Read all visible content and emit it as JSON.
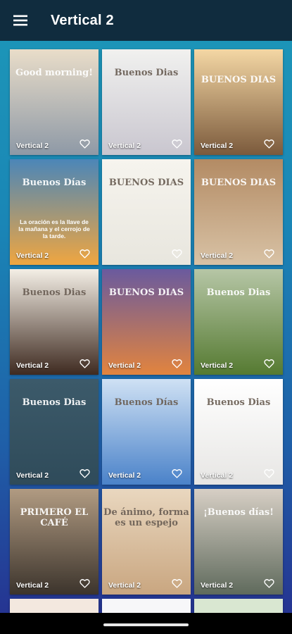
{
  "app_bar": {
    "title": "Vertical 2",
    "menu_icon": "hamburger-menu-icon"
  },
  "gallery": {
    "items": [
      {
        "label": "Vertical 2",
        "art_text": "Good morning!",
        "colors": [
          "#e9ddc9",
          "#8e99a6"
        ],
        "icon": "heart-outline-icon"
      },
      {
        "label": "Vertical 2",
        "art_text": "Buenos Dias",
        "colors": [
          "#f1f1ef",
          "#c9c6cf"
        ],
        "icon": "heart-outline-icon"
      },
      {
        "label": "Vertical 2",
        "art_text": "BUENOS DIAS",
        "colors": [
          "#f4d7a4",
          "#7b5a3c"
        ],
        "icon": "heart-outline-icon"
      },
      {
        "label": "Vertical 2",
        "art_text": "Buenos Días",
        "quote": "La oración es la llave de la mañana y el cerrojo de la tarde.",
        "colors": [
          "#4b86b8",
          "#f0a640"
        ],
        "icon": "heart-outline-icon"
      },
      {
        "label": "",
        "art_text": "BUENOS DIAS",
        "colors": [
          "#f6f4ee",
          "#e8e6de"
        ],
        "icon": "heart-outline-icon"
      },
      {
        "label": "Vertical 2",
        "art_text": "BUENOS DIAS",
        "colors": [
          "#b38b64",
          "#d8c2a5"
        ],
        "icon": "heart-outline-icon"
      },
      {
        "label": "Vertical 2",
        "art_text": "Buenos Dias",
        "colors": [
          "#f4efe6",
          "#3e2a20"
        ],
        "icon": "heart-outline-icon"
      },
      {
        "label": "Vertical 2",
        "art_text": "BUENOS DIAS",
        "colors": [
          "#6a5a9e",
          "#e2843e"
        ],
        "icon": "heart-outline-icon"
      },
      {
        "label": "Vertical 2",
        "art_text": "Buenos Dias",
        "colors": [
          "#b6c6a6",
          "#557a31"
        ],
        "icon": "heart-outline-icon"
      },
      {
        "label": "Vertical 2",
        "art_text": "Buenos Dias",
        "colors": [
          "#3c5a6a",
          "#2f4b5a"
        ],
        "icon": "heart-outline-icon"
      },
      {
        "label": "Vertical 2",
        "art_text": "Buenos Días",
        "colors": [
          "#cfe1f4",
          "#4a82c9"
        ],
        "icon": "heart-outline-icon"
      },
      {
        "label": "Vertical 2",
        "art_text": "Buenos Dias",
        "colors": [
          "#ffffff",
          "#e7e6e4"
        ],
        "icon": "heart-outline-icon"
      },
      {
        "label": "Vertical 2",
        "art_text": "PRIMERO EL CAFÉ",
        "colors": [
          "#b19b82",
          "#3c342c"
        ],
        "icon": "heart-outline-icon"
      },
      {
        "label": "Vertical 2",
        "art_text": "De ánimo, forma es un espejo",
        "colors": [
          "#e9d7bf",
          "#c9a680"
        ],
        "icon": "heart-outline-icon"
      },
      {
        "label": "Vertical 2",
        "art_text": "¡Buenos días!",
        "colors": [
          "#d7cfc5",
          "#5f6a5c"
        ],
        "icon": "heart-outline-icon"
      }
    ]
  },
  "system": {
    "home_indicator": "home-indicator"
  }
}
